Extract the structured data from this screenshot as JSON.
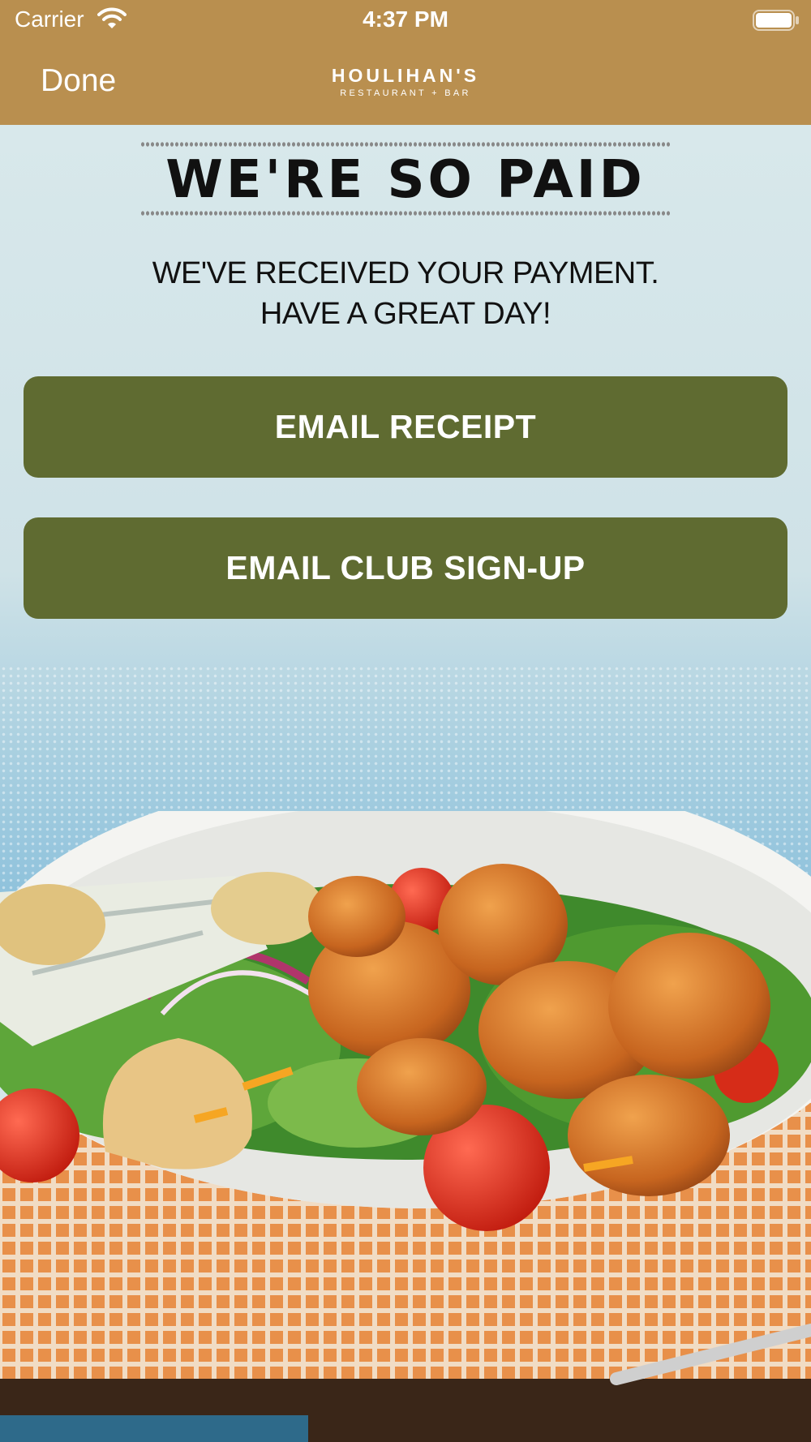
{
  "status_bar": {
    "carrier": "Carrier",
    "time": "4:37 PM"
  },
  "nav": {
    "done_label": "Done"
  },
  "brand": {
    "logo_main": "HOULIHAN'S",
    "logo_sub": "RESTAURANT + BAR"
  },
  "main": {
    "headline": "WE'RE SO PAID",
    "message_line1": "WE'VE RECEIVED YOUR PAYMENT.",
    "message_line2": "HAVE A GREAT DAY!",
    "email_receipt_label": "EMAIL RECEIPT",
    "email_club_label": "EMAIL CLUB SIGN-UP"
  },
  "colors": {
    "header": "#b98f4f",
    "button": "#5f6b31",
    "background": "#d6e6ea"
  },
  "icons": [
    "wifi-icon",
    "battery-icon"
  ]
}
